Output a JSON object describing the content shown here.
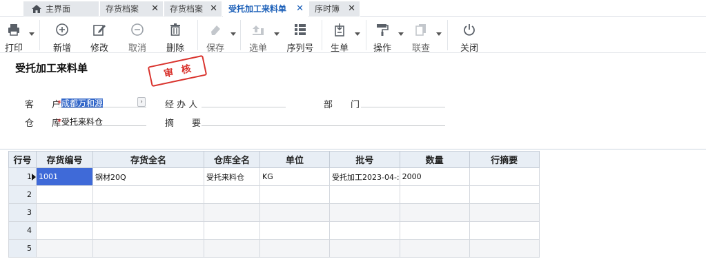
{
  "tabs": [
    {
      "label": "主界面",
      "closable": false,
      "active": false
    },
    {
      "label": "存货档案",
      "closable": true,
      "active": false
    },
    {
      "label": "存货档案",
      "closable": true,
      "active": false
    },
    {
      "label": "受托加工来料单",
      "closable": true,
      "active": true
    },
    {
      "label": "序时簿",
      "closable": true,
      "active": false
    }
  ],
  "close_glyph": "✕",
  "toolbar": {
    "print": "打印",
    "add": "新增",
    "edit": "修改",
    "cancel": "取消",
    "delete": "删除",
    "save": "保存",
    "select": "选单",
    "serial": "序列号",
    "generate": "生单",
    "operate": "操作",
    "query": "联查",
    "close": "关闭"
  },
  "form": {
    "title": "受托加工来料单",
    "stamp": "审核",
    "customer_label": "客　　户",
    "customer_value": "成都万和源",
    "handler_label": "经 办 人",
    "handler_value": "",
    "dept_label": "部　　门",
    "dept_value": "",
    "warehouse_label": "仓　　库",
    "warehouse_value": "受托来料仓",
    "remark_label": "摘　　要",
    "remark_value": "",
    "required_mark": "*",
    "picker_glyph": "›"
  },
  "grid": {
    "columns": [
      "行号",
      "存货编号",
      "存货全名",
      "仓库全名",
      "单位",
      "批号",
      "数量",
      "行摘要"
    ],
    "rows": [
      {
        "no": "1",
        "code": "1001",
        "name": "钢材20Q",
        "warehouse": "受托来料仓",
        "unit": "KG",
        "batch": "受托加工2023-04-:",
        "qty": "2000",
        "remark": ""
      },
      {
        "no": "2",
        "code": "",
        "name": "",
        "warehouse": "",
        "unit": "",
        "batch": "",
        "qty": "",
        "remark": ""
      },
      {
        "no": "3",
        "code": "",
        "name": "",
        "warehouse": "",
        "unit": "",
        "batch": "",
        "qty": "",
        "remark": ""
      },
      {
        "no": "4",
        "code": "",
        "name": "",
        "warehouse": "",
        "unit": "",
        "batch": "",
        "qty": "",
        "remark": ""
      },
      {
        "no": "5",
        "code": "",
        "name": "",
        "warehouse": "",
        "unit": "",
        "batch": "",
        "qty": "",
        "remark": ""
      }
    ]
  },
  "colors": {
    "accent": "#1b5fb8",
    "stamp": "#d9332d",
    "selected_cell": "#3f6ad8",
    "header_bg": "#e8eef5"
  }
}
